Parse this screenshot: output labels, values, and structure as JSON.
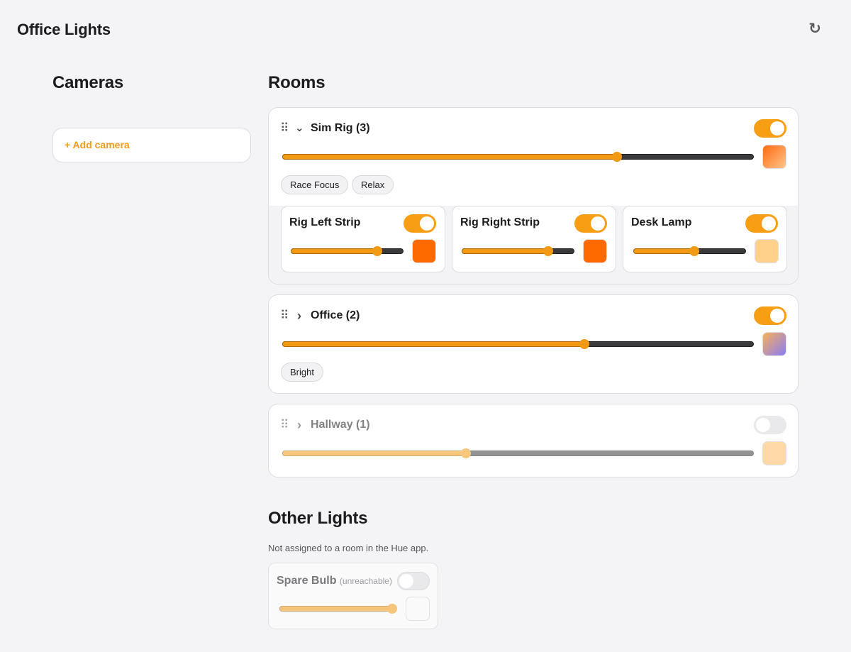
{
  "app": {
    "title": "Office Lights",
    "refresh_icon": "refresh-icon"
  },
  "cameras": {
    "title": "Cameras",
    "add_label": "+ Add camera"
  },
  "rooms": {
    "title": "Rooms",
    "items": [
      {
        "name": "Sim Rig (3)",
        "expanded": true,
        "on": true,
        "brightness_percent": 71,
        "swatch_gradient": [
          "#ff6a10",
          "#ffc58a"
        ],
        "scenes": [
          "Race Focus",
          "Relax"
        ],
        "lights": [
          {
            "name": "Rig Left Strip",
            "on": true,
            "brightness_percent": 77,
            "color": "#ff6a00"
          },
          {
            "name": "Rig Right Strip",
            "on": true,
            "brightness_percent": 77,
            "color": "#ff6a00"
          },
          {
            "name": "Desk Lamp",
            "on": true,
            "brightness_percent": 54,
            "color": "#ffd18a"
          }
        ]
      },
      {
        "name": "Office (2)",
        "expanded": false,
        "on": true,
        "brightness_percent": 64,
        "swatch_gradient": [
          "#f7b05a",
          "#8a7cf6"
        ],
        "scenes": [
          "Bright"
        ]
      },
      {
        "name": "Hallway (1)",
        "expanded": false,
        "on": false,
        "brightness_percent": 39,
        "swatch_gradient": [
          "#ffd9a8",
          "#ffd9a8"
        ],
        "scenes": []
      }
    ]
  },
  "other_lights": {
    "title": "Other Lights",
    "subtitle": "Not assigned to a room in the Hue app.",
    "items": [
      {
        "name": "Spare Bulb",
        "status": "(unreachable)",
        "on": false,
        "brightness_percent": 100
      }
    ]
  },
  "icons": {
    "drag": "drag-handle-icon",
    "expanded": "chevron-down-icon",
    "collapsed": "chevron-right-icon"
  },
  "colors": {
    "accent": "#f29a14",
    "toggle_on": "#f79e14",
    "background": "#f4f4f6"
  }
}
